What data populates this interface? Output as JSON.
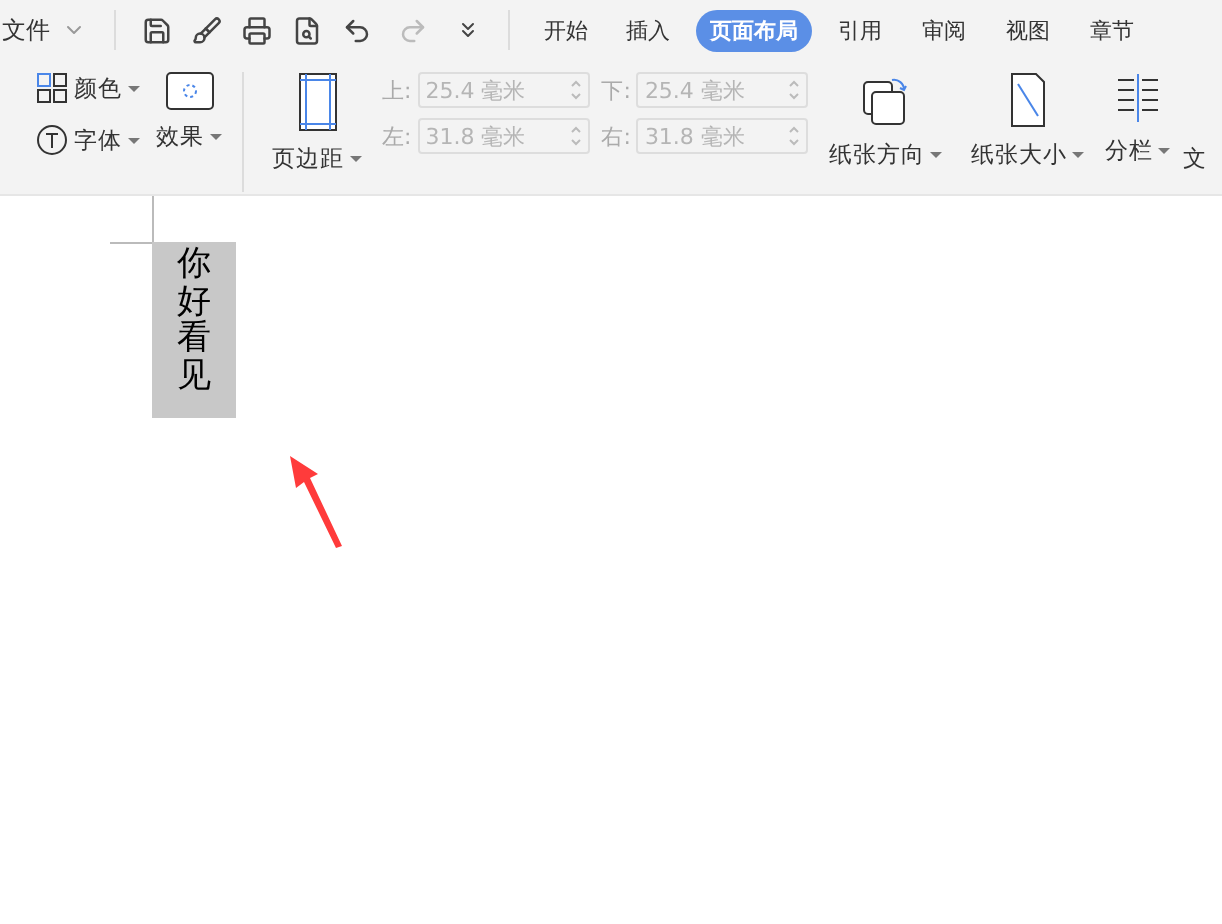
{
  "menu": {
    "label": "文件"
  },
  "tabs": [
    {
      "label": "开始",
      "selected": false
    },
    {
      "label": "插入",
      "selected": false
    },
    {
      "label": "页面布局",
      "selected": true
    },
    {
      "label": "引用",
      "selected": false
    },
    {
      "label": "审阅",
      "selected": false
    },
    {
      "label": "视图",
      "selected": false
    },
    {
      "label": "章节",
      "selected": false
    }
  ],
  "ribbon": {
    "color_label": "颜色",
    "font_label": "字体",
    "effect_label": "效果",
    "margins_label": "页边距",
    "margin_fields": [
      {
        "label": "上:",
        "value": "25.4 毫米",
        "disabled": true
      },
      {
        "label": "下:",
        "value": "25.4 毫米",
        "disabled": true
      },
      {
        "label": "左:",
        "value": "31.8 毫米",
        "disabled": true
      },
      {
        "label": "右:",
        "value": "31.8 毫米",
        "disabled": true
      }
    ],
    "orientation_label": "纸张方向",
    "size_label": "纸张大小",
    "columns_label": "分栏",
    "cut_label": "文"
  },
  "document": {
    "text": "你好看见",
    "selected": true
  }
}
